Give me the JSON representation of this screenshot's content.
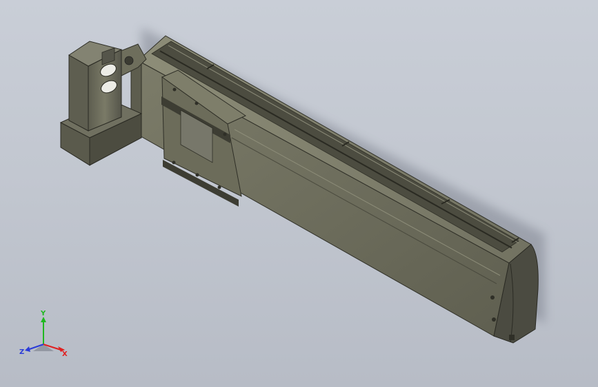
{
  "viewport": {
    "background_top": "#c9ced7",
    "background_bottom": "#b7bcc6"
  },
  "model": {
    "body_color": "#6f6f5e",
    "body_dark": "#3c3b31",
    "body_light": "#8f8f7a",
    "end_cap_color": "#4b4b41"
  },
  "triad": {
    "x_label": "X",
    "y_label": "Y",
    "z_label": "Z",
    "x_color": "#e02020",
    "y_color": "#1fb81f",
    "z_color": "#2a3bd8"
  }
}
